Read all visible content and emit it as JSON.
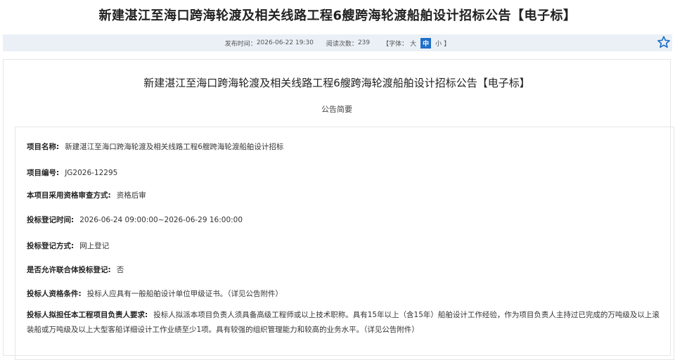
{
  "header": {
    "title": "新建湛江至海口跨海轮渡及相关线路工程6艘跨海轮渡船舶设计招标公告【电子标】"
  },
  "meta": {
    "publish_label": "发布时间：",
    "publish_time": "2026-06-22 19:30",
    "views_label": "阅读次数：",
    "views": "239",
    "font_prefix": "【字体：",
    "font_large": "大",
    "font_medium": "中",
    "font_small": "小",
    "font_suffix": "】"
  },
  "article": {
    "title": "新建湛江至海口跨海轮渡及相关线路工程6艘跨海轮渡船舶设计招标公告【电子标】",
    "subtitle": "公告简要",
    "fields": [
      {
        "label": "项目名称:",
        "value": "新建湛江至海口跨海轮渡及相关线路工程6艘跨海轮渡船舶设计招标"
      },
      {
        "label": "项目编号:",
        "value": "JG2026-12295"
      },
      {
        "label": "本项目采用资格审查方式:",
        "value": "资格后审"
      },
      {
        "label": "投标登记时间:",
        "value": "2026-06-24 09:00:00~2026-06-29 16:00:00"
      },
      {
        "label": "投标登记方式:",
        "value": "网上登记"
      },
      {
        "label": "是否允许联合体投标登记:",
        "value": "否"
      },
      {
        "label": "投标人资格条件:",
        "value": "投标人应具有一般船舶设计单位甲级证书。（详见公告附件）"
      },
      {
        "label": "投标人拟担任本工程项目负责人要求:",
        "value": "投标人拟派本项目负责人须具备高级工程师或以上技术职称。具有15年以上（含15年）船舶设计工作经验，作为项目负责人主持过已完成的万吨级及以上滚装船或万吨级及以上大型客船详细设计工作业绩至少1项。具有较强的组织管理能力和较高的业务水平。（详见公告附件）"
      }
    ]
  },
  "icons": {
    "favorite": "star-icon"
  },
  "colors": {
    "accent": "#1f6fc9",
    "meta_bg": "#eaf0f6"
  }
}
